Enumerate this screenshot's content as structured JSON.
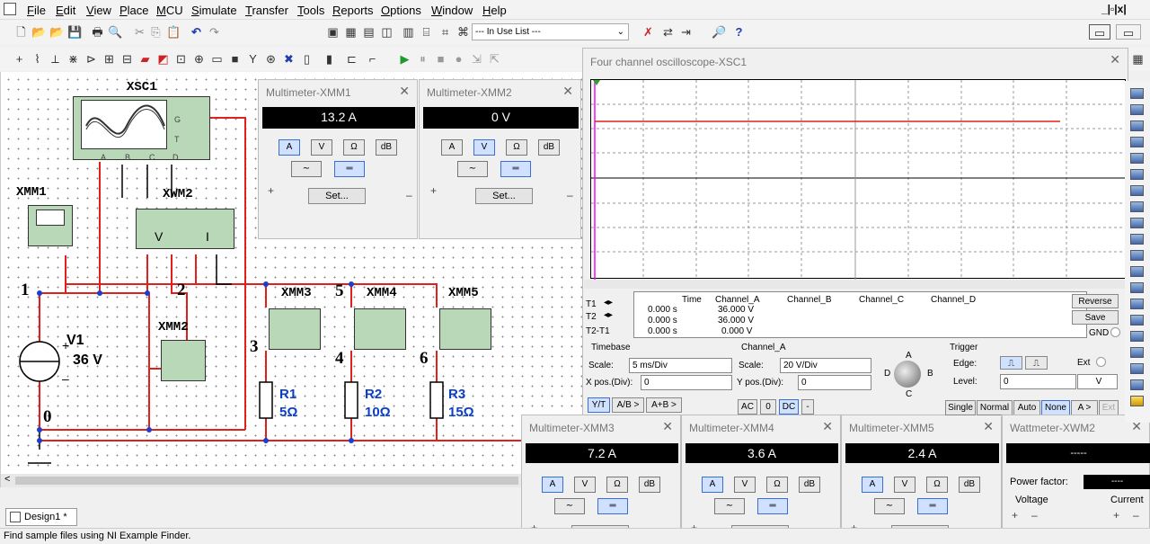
{
  "menu": [
    "File",
    "Edit",
    "View",
    "Place",
    "MCU",
    "Simulate",
    "Transfer",
    "Tools",
    "Reports",
    "Options",
    "Window",
    "Help"
  ],
  "toolbar": {
    "in_use_list": "--- In Use List ---",
    "help_icon": "?"
  },
  "circuit": {
    "scope": "XSC1",
    "xmm1": "XMM1",
    "xwm2": "XWM2",
    "xmm2": "XMM2",
    "xmm3": "XMM3",
    "xmm4": "XMM4",
    "xmm5": "XMM5",
    "v1": "V1",
    "v1_value": "36 V",
    "plus": "+",
    "minus": "–",
    "r1": "R1",
    "r1_value": "5Ω",
    "r2": "R2",
    "r2_value": "10Ω",
    "r3": "R3",
    "r3_value": "15Ω",
    "node0": "0",
    "node1": "1",
    "node2": "2",
    "node3": "3",
    "node4": "4",
    "node5": "5",
    "node6": "6",
    "scope_g": "G",
    "scope_t": "T",
    "scope_a": "A",
    "scope_b": "B",
    "scope_c": "C",
    "scope_d": "D",
    "wm_v": "V",
    "wm_i": "I"
  },
  "multimeters": [
    {
      "title": "Multimeter-XMM1",
      "reading": "13.2 A",
      "mode": "A"
    },
    {
      "title": "Multimeter-XMM2",
      "reading": "0 V",
      "mode": "V"
    },
    {
      "title": "Multimeter-XMM3",
      "reading": "7.2 A",
      "mode": "A"
    },
    {
      "title": "Multimeter-XMM4",
      "reading": "3.6 A",
      "mode": "A"
    },
    {
      "title": "Multimeter-XMM5",
      "reading": "2.4 A",
      "mode": "A"
    }
  ],
  "mm_buttons": {
    "a": "A",
    "v": "V",
    "ohm": "Ω",
    "db": "dB",
    "set": "Set...",
    "plus": "+",
    "minus": "–"
  },
  "oscilloscope": {
    "title": "Four channel oscilloscope-XSC1",
    "header": [
      "Time",
      "Channel_A",
      "Channel_B",
      "Channel_C",
      "Channel_D"
    ],
    "rows": [
      {
        "label": "T1",
        "time": "0.000 s",
        "a": "36.000 V"
      },
      {
        "label": "T2",
        "time": "0.000 s",
        "a": "36.000 V"
      },
      {
        "label": "T2-T1",
        "time": "0.000 s",
        "a": "0.000 V"
      }
    ],
    "reverse": "Reverse",
    "save": "Save",
    "gnd": "GND",
    "timebase": "Timebase",
    "scale_label": "Scale:",
    "timebase_scale": "5 ms/Div",
    "xpos_label": "X pos.(Div):",
    "xpos": "0",
    "yt": "Y/T",
    "ab": "A/B >",
    "apb": "A+B >",
    "channel": "Channel_A",
    "ch_scale": "20 V/Div",
    "ypos_label": "Y pos.(Div):",
    "ypos": "0",
    "ac": "AC",
    "zero": "0",
    "dc": "DC",
    "dash": "-",
    "knob_a": "A",
    "knob_b": "B",
    "knob_c": "C",
    "knob_d": "D",
    "trigger": "Trigger",
    "edge_label": "Edge:",
    "ext": "Ext",
    "level_label": "Level:",
    "level": "0",
    "level_unit": "V",
    "single": "Single",
    "normal": "Normal",
    "auto": "Auto",
    "none": "None",
    "a_gt": "A >",
    "ext_btn": "Ext"
  },
  "wattmeter": {
    "title": "Wattmeter-XWM2",
    "reading": "-----",
    "pf_label": "Power factor:",
    "pf_value": "----",
    "voltage": "Voltage",
    "current": "Current",
    "plus": "+",
    "minus": "–"
  },
  "tab": "Design1 *",
  "status": "Find sample files using NI Example Finder.",
  "colors": {
    "wire": "#e0211b",
    "trace": "#e0211b",
    "label_blue": "#0b3fc6"
  }
}
